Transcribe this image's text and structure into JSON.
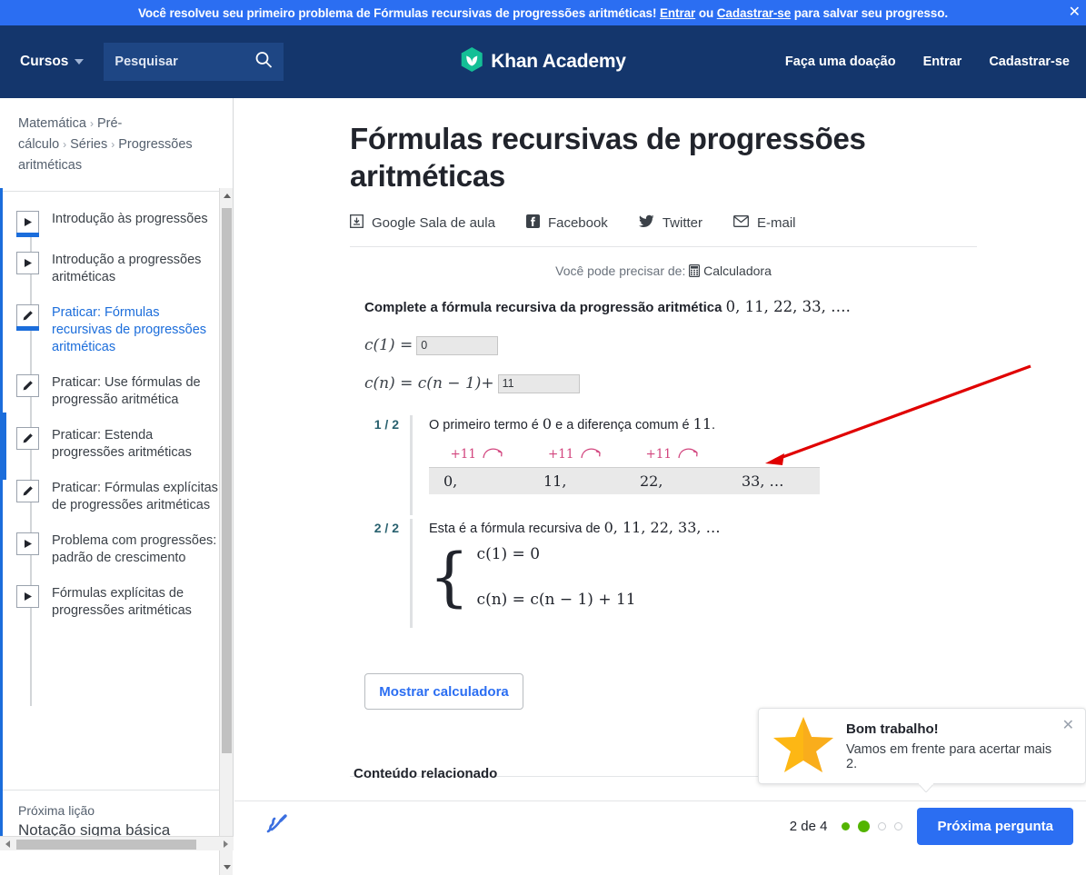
{
  "banner": {
    "text_before": "Você resolveu seu primeiro problema de Fórmulas recursivas de progressões aritméticas!",
    "login_link": "Entrar",
    "or": "ou",
    "signup_link": "Cadastrar-se",
    "text_after": "para salvar seu progresso.",
    "close_icon": "close-icon",
    "bg_color": "#2b6ef2"
  },
  "nav": {
    "courses": "Cursos",
    "search_placeholder": "Pesquisar",
    "search_value": "",
    "search_icon": "search-icon",
    "logo_text": "Khan Academy",
    "logo_icon": "khan-academy-leaf-icon",
    "logo_color": "#14bf96",
    "donate": "Faça uma doação",
    "login": "Entrar",
    "signup": "Cadastrar-se",
    "bg_color": "#14366c"
  },
  "sidebar": {
    "breadcrumb": [
      "Matemática",
      "Pré-cálculo",
      "Séries",
      "Progressões aritméticas"
    ],
    "items": [
      {
        "label": "Introdução às progressões",
        "icon": "video-icon",
        "state": "completed",
        "active": false
      },
      {
        "label": "Introdução a progressões aritméticas",
        "icon": "video-icon",
        "state": "none",
        "active": false
      },
      {
        "label": "Praticar: Fórmulas recursivas de progressões aritméticas",
        "icon": "exercise-icon",
        "state": "completed",
        "active": true
      },
      {
        "label": "Praticar: Use fórmulas de progressão aritmética",
        "icon": "exercise-icon",
        "state": "none",
        "active": false
      },
      {
        "label": "Praticar: Estenda progressões aritméticas",
        "icon": "exercise-icon",
        "state": "none",
        "active": false
      },
      {
        "label": "Praticar: Fórmulas explícitas de progressões aritméticas",
        "icon": "exercise-icon",
        "state": "none",
        "active": false
      },
      {
        "label": "Problema com progressões: padrão de crescimento",
        "icon": "video-icon",
        "state": "none",
        "active": false
      },
      {
        "label": "Fórmulas explícitas de progressões aritméticas",
        "icon": "video-icon",
        "state": "none",
        "active": false
      }
    ],
    "next_lesson_label": "Próxima lição",
    "next_lesson_title": "Notação sigma básica",
    "active_color": "#1b6ddb"
  },
  "main": {
    "title": "Fórmulas recursivas de progressões aritméticas",
    "share": [
      {
        "label": "Google Sala de aula",
        "icon": "google-classroom-icon"
      },
      {
        "label": "Facebook",
        "icon": "facebook-icon"
      },
      {
        "label": "Twitter",
        "icon": "twitter-icon"
      },
      {
        "label": "E-mail",
        "icon": "email-icon"
      }
    ],
    "you_may_need": "Você pode precisar de:",
    "calculator_label": "Calculadora",
    "calculator_icon": "calculator-icon",
    "prompt_text": "Complete a fórmula recursiva da progressão aritmética",
    "prompt_sequence": "0, 11, 22, 33, ….",
    "equations": [
      {
        "label": "c(1) =",
        "answer": "0"
      },
      {
        "label": "c(n) = c(n − 1)+",
        "answer": "11"
      }
    ],
    "show_calculator_button": "Mostrar calculadora",
    "related_content": "Conteúdo relacionado"
  },
  "hints": [
    {
      "number": "1 / 2",
      "text_parts": [
        "O primeiro termo é",
        "0",
        "e a diferença comum é",
        "11",
        "."
      ],
      "sequence": {
        "ops": [
          "+11",
          "+11",
          "+11"
        ],
        "terms": [
          "0,",
          "11,",
          "22,",
          "33, …"
        ],
        "op_color": "#d2457e"
      }
    },
    {
      "number": "2 / 2",
      "text": "Esta é a fórmula recursiva de",
      "sequence_text": "0, 11, 22, 33, …",
      "formula_line1": "c(1) = 0",
      "formula_line2": "c(n) = c(n − 1) + 11"
    }
  ],
  "toast": {
    "icon": "star-icon",
    "title": "Bom trabalho!",
    "message": "Vamos em frente para acertar mais 2.",
    "close_icon": "close-icon",
    "star_color": "#ffb busca"
  },
  "footer": {
    "draw_icon": "scribble-draw-icon",
    "counter": "2 de 4",
    "dots": [
      "green",
      "green-current",
      "empty",
      "empty"
    ],
    "next_button": "Próxima pergunta",
    "next_button_color": "#2b6ef2",
    "dot_green": "#53b400"
  },
  "annotation": {
    "arrow_color": "#e00000",
    "from": "1135,405",
    "to": "843,512"
  }
}
